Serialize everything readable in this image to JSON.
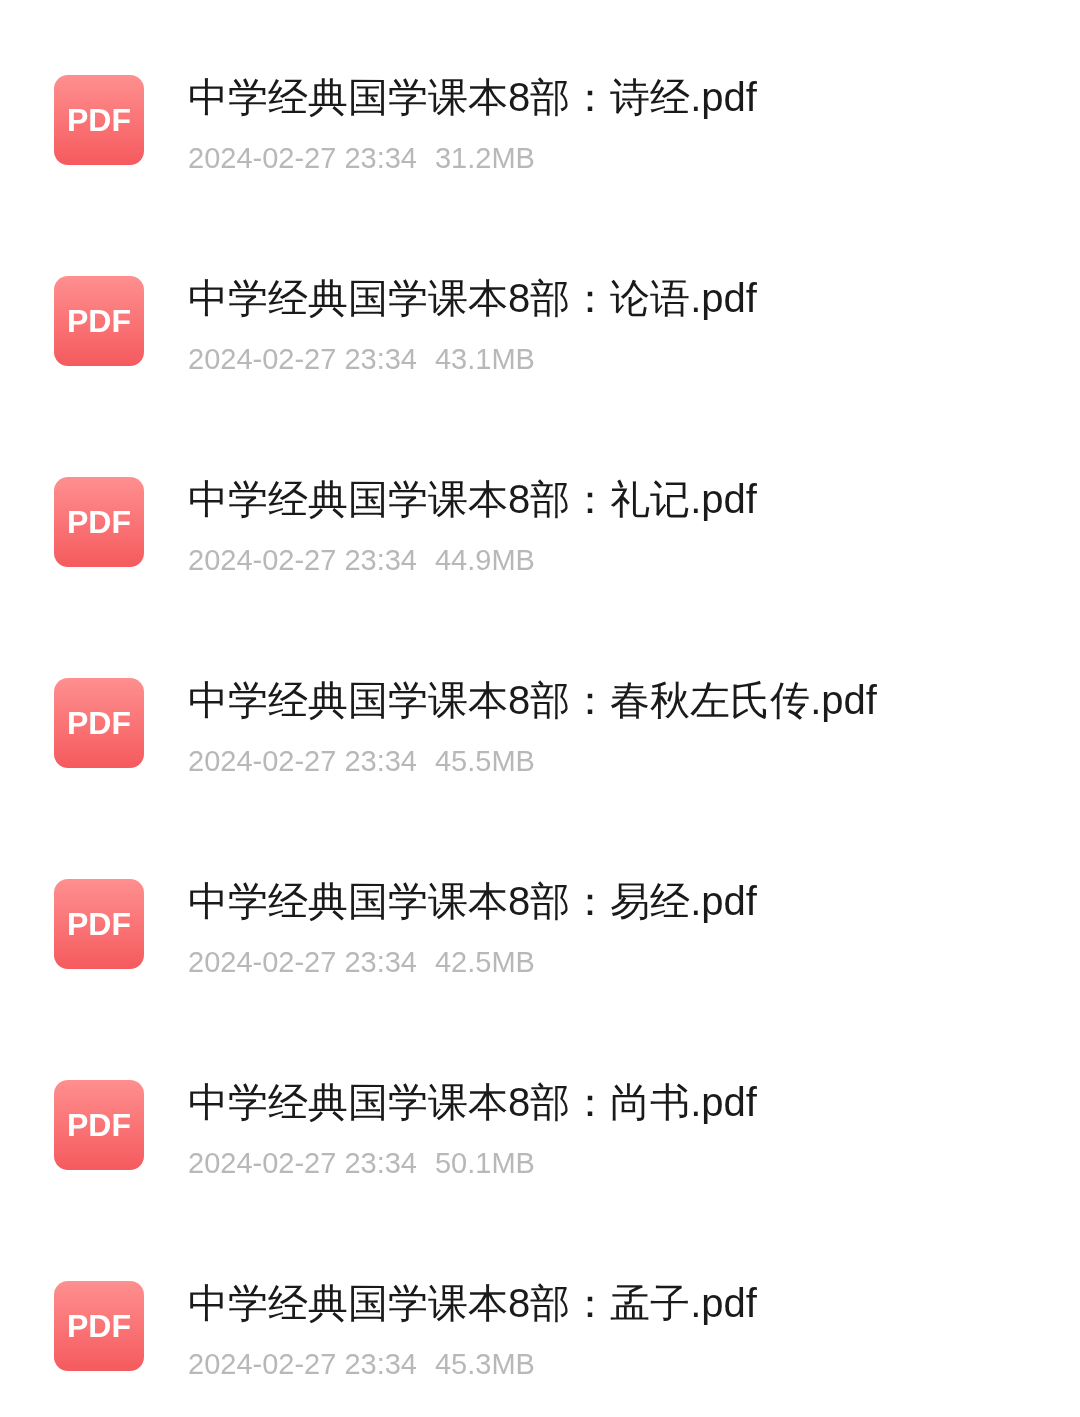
{
  "files": [
    {
      "icon_label": "PDF",
      "name": "中学经典国学课本8部：诗经.pdf",
      "date": "2024-02-27 23:34",
      "size": "31.2MB"
    },
    {
      "icon_label": "PDF",
      "name": "中学经典国学课本8部：论语.pdf",
      "date": "2024-02-27 23:34",
      "size": "43.1MB"
    },
    {
      "icon_label": "PDF",
      "name": "中学经典国学课本8部：礼记.pdf",
      "date": "2024-02-27 23:34",
      "size": "44.9MB"
    },
    {
      "icon_label": "PDF",
      "name": "中学经典国学课本8部：春秋左氏传.pdf",
      "date": "2024-02-27 23:34",
      "size": "45.5MB"
    },
    {
      "icon_label": "PDF",
      "name": "中学经典国学课本8部：易经.pdf",
      "date": "2024-02-27 23:34",
      "size": "42.5MB"
    },
    {
      "icon_label": "PDF",
      "name": "中学经典国学课本8部：尚书.pdf",
      "date": "2024-02-27 23:34",
      "size": "50.1MB"
    },
    {
      "icon_label": "PDF",
      "name": "中学经典国学课本8部：孟子.pdf",
      "date": "2024-02-27 23:34",
      "size": "45.3MB"
    }
  ]
}
